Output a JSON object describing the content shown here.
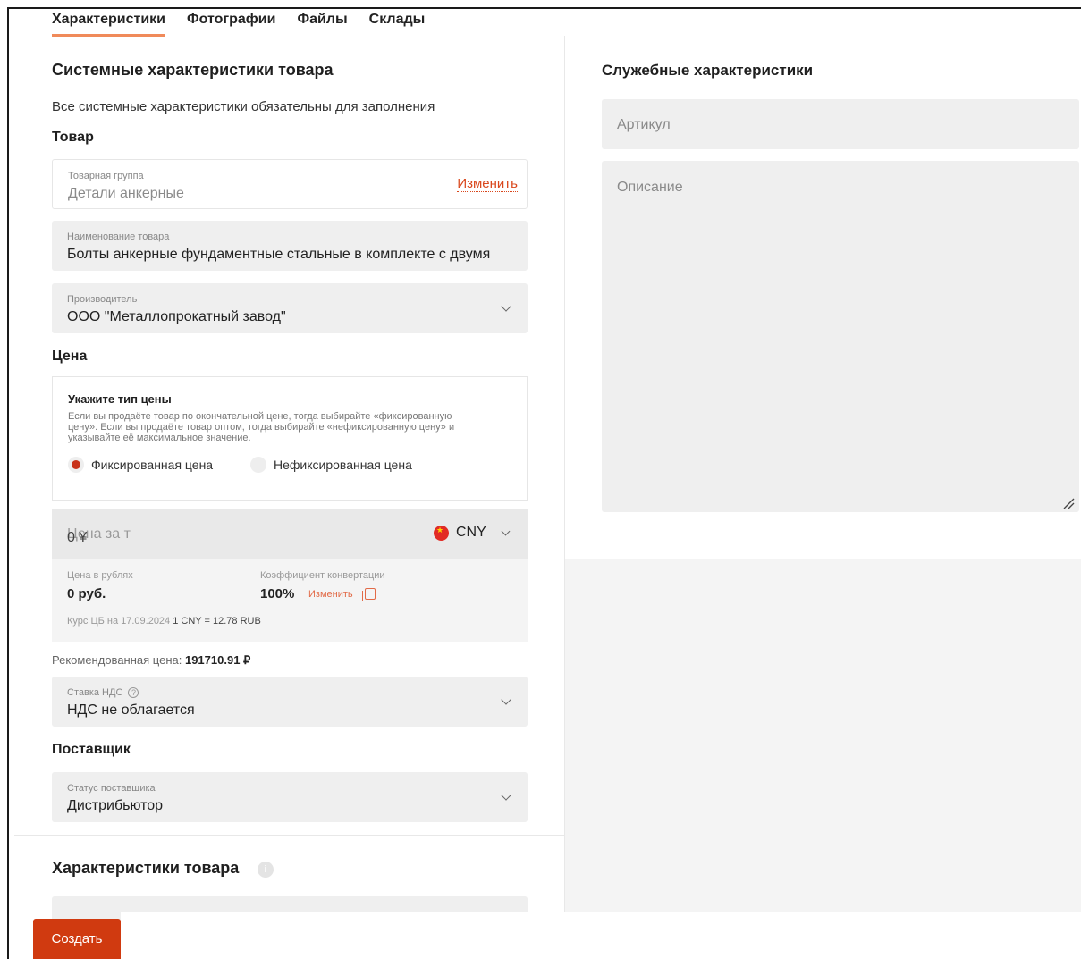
{
  "tabs": [
    {
      "label": "Характеристики",
      "active": true
    },
    {
      "label": "Фотографии",
      "active": false
    },
    {
      "label": "Файлы",
      "active": false
    },
    {
      "label": "Склады",
      "active": false
    }
  ],
  "system": {
    "title": "Системные характеристики товара",
    "note": "Все системные характеристики обязательны для заполнения",
    "product_heading": "Товар",
    "product_group": {
      "label": "Товарная группа",
      "value": "Детали анкерные",
      "change_label": "Изменить"
    },
    "product_name": {
      "label": "Наименование товара",
      "value": "Болты анкерные фундаментные стальные в комплекте с двумя"
    },
    "manufacturer": {
      "label": "Производитель",
      "value": "ООО \"Металлопрокатный завод\""
    },
    "price_heading": "Цена",
    "price_type": {
      "title": "Укажите тип цены",
      "description": "Если вы продаёте товар по окончательной цене, тогда выбирайте «фиксированную цену». Если вы продаёте товар оптом, тогда выбирайте «нефиксированную цену» и указывайте её максимальное значение.",
      "fixed_label": "Фиксированная цена",
      "floating_label": "Нефиксированная цена",
      "selected": "fixed"
    },
    "price_field": {
      "placeholder": "Цена за т",
      "value": "0 ¥",
      "currency": "CNY"
    },
    "conversion": {
      "rub_label": "Цена в рублях",
      "rub_value": "0 руб.",
      "coef_label": "Коэффициент конвертации",
      "coef_value": "100%",
      "change_label": "Изменить",
      "rate_prefix": "Курс ЦБ на 17.09.2024",
      "rate_value": "1 CNY = 12.78 RUB"
    },
    "recommended": {
      "label": "Рекомендованная цена:",
      "value": "191710.91 ₽"
    },
    "vat": {
      "label": "Ставка НДС",
      "value": "НДС не облагается"
    },
    "supplier_heading": "Поставщик",
    "supplier_status": {
      "label": "Статус поставщика",
      "value": "Дистрибьютор"
    }
  },
  "product_chars": {
    "title": "Характеристики товара"
  },
  "service": {
    "title": "Служебные характеристики",
    "article_placeholder": "Артикул",
    "description_placeholder": "Описание"
  },
  "actions": {
    "create_label": "Создать"
  },
  "colors": {
    "accent": "#d03a10",
    "link": "#d9471c",
    "tab_underline": "#f08a5a"
  },
  "icons": [
    "chevron-down-icon",
    "help-icon",
    "info-icon",
    "copy-icon",
    "cny-flag-icon",
    "resize-handle-icon"
  ]
}
